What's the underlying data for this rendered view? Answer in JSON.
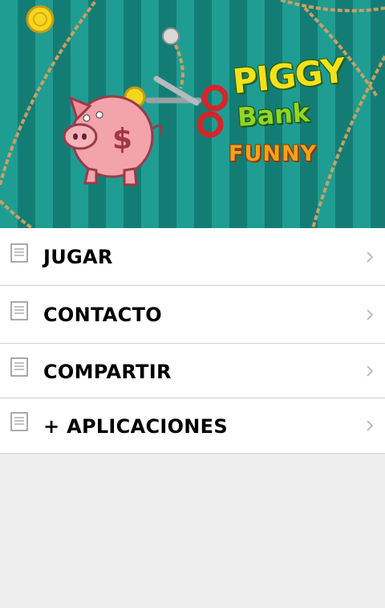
{
  "banner": {
    "logo_line1": "PIGGY",
    "logo_line2": "Bank",
    "logo_line3": "FUNNY"
  },
  "menu": {
    "items": [
      {
        "label": "JUGAR",
        "icon": "document-icon"
      },
      {
        "label": "CONTACTO",
        "icon": "document-icon"
      },
      {
        "label": "COMPARTIR",
        "icon": "document-icon"
      },
      {
        "label": "+ APLICACIONES",
        "icon": "document-icon"
      }
    ]
  },
  "colors": {
    "banner_stripe_light": "#1f9d93",
    "banner_stripe_dark": "#137d75",
    "menu_background": "#ffffff",
    "page_background": "#eeeeee",
    "divider": "#cfcfcf"
  }
}
